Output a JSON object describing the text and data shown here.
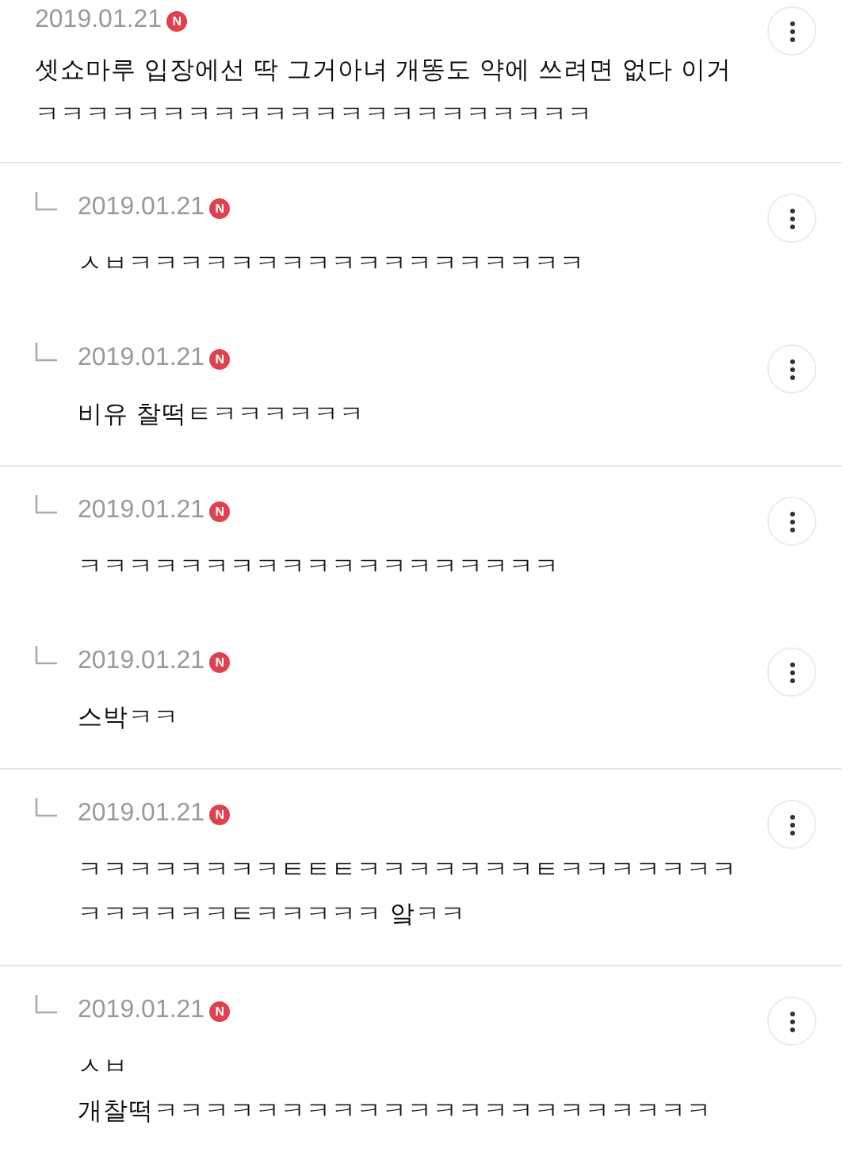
{
  "threads": [
    {
      "comments": [
        {
          "reply": false,
          "date": "2019.01.21",
          "badge": "N",
          "text": "셋쇼마루 입장에선 딱 그거아녀 개똥도 약에 쓰려면 없다 이거 ㅋㅋㅋㅋㅋㅋㅋㅋㅋㅋㅋㅋㅋㅋㅋㅋㅋㅋㅋㅋㅋㅋ"
        }
      ]
    },
    {
      "comments": [
        {
          "reply": true,
          "date": "2019.01.21",
          "badge": "N",
          "text": "ㅅㅂㅋㅋㅋㅋㅋㅋㅋㅋㅋㅋㅋㅋㅋㅋㅋㅋㅋㅋ"
        },
        {
          "reply": true,
          "date": "2019.01.21",
          "badge": "N",
          "text": "비유 찰떡ㅌㅋㅋㅋㅋㅋㅋ"
        }
      ]
    },
    {
      "comments": [
        {
          "reply": true,
          "date": "2019.01.21",
          "badge": "N",
          "text": "ㅋㅋㅋㅋㅋㅋㅋㅋㅋㅋㅋㅋㅋㅋㅋㅋㅋㅋㅋ"
        },
        {
          "reply": true,
          "date": "2019.01.21",
          "badge": "N",
          "text": "스박ㅋㅋ"
        }
      ]
    },
    {
      "comments": [
        {
          "reply": true,
          "date": "2019.01.21",
          "badge": "N",
          "text": "ㅋㅋㅋㅋㅋㅋㅋㅋㅌㅌㅌㅋㅋㅋㅋㅋㅋㅋㅌㅋㅋㅋㅋㅋㅋㅋㅋㅋㅋㅋㅋㅋㅌㅋㅋㅋㅋㅋ 앜ㅋㅋ"
        }
      ]
    },
    {
      "comments": [
        {
          "reply": true,
          "date": "2019.01.21",
          "badge": "N",
          "text": "ㅅㅂ\n개찰떡ㅋㅋㅋㅋㅋㅋㅋㅋㅋㅋㅋㅋㅋㅋㅋㅋㅋㅋㅋㅋㅋㅋ"
        }
      ]
    }
  ]
}
